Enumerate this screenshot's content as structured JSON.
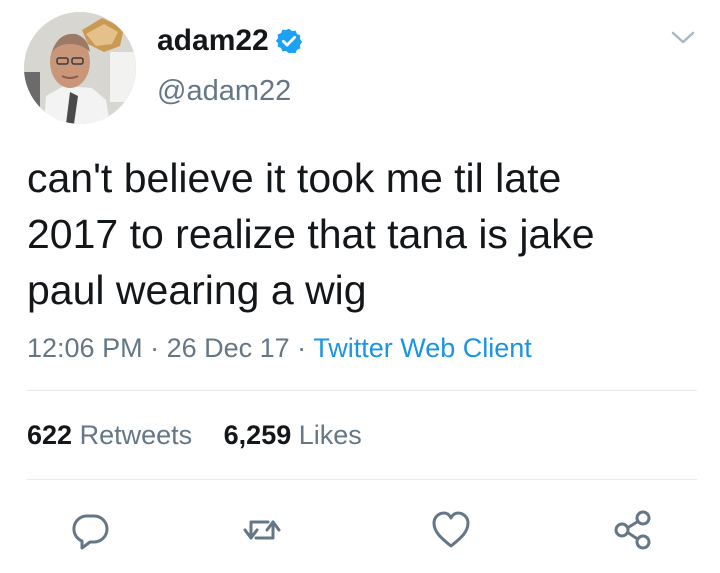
{
  "user": {
    "display_name": "adam22",
    "handle": "@adam22",
    "verified": true,
    "avatar_icon": "profile-photo"
  },
  "tweet": {
    "text": "can't believe it took me til late\n2017 to realize that tana is jake\npaul wearing a wig",
    "time": "12:06 PM",
    "separator": " · ",
    "date": "26 Dec 17",
    "source": "Twitter Web Client"
  },
  "stats": {
    "retweets_count": "622",
    "retweets_label": "Retweets",
    "likes_count": "6,259",
    "likes_label": "Likes"
  },
  "actions": {
    "reply_icon": "reply-icon",
    "retweet_icon": "retweet-icon",
    "like_icon": "heart-icon",
    "share_icon": "share-icon"
  },
  "colors": {
    "text": "#14171a",
    "secondary": "#657786",
    "link": "#1b95e0",
    "verified": "#1da1f2",
    "divider": "#e6ecf0"
  }
}
